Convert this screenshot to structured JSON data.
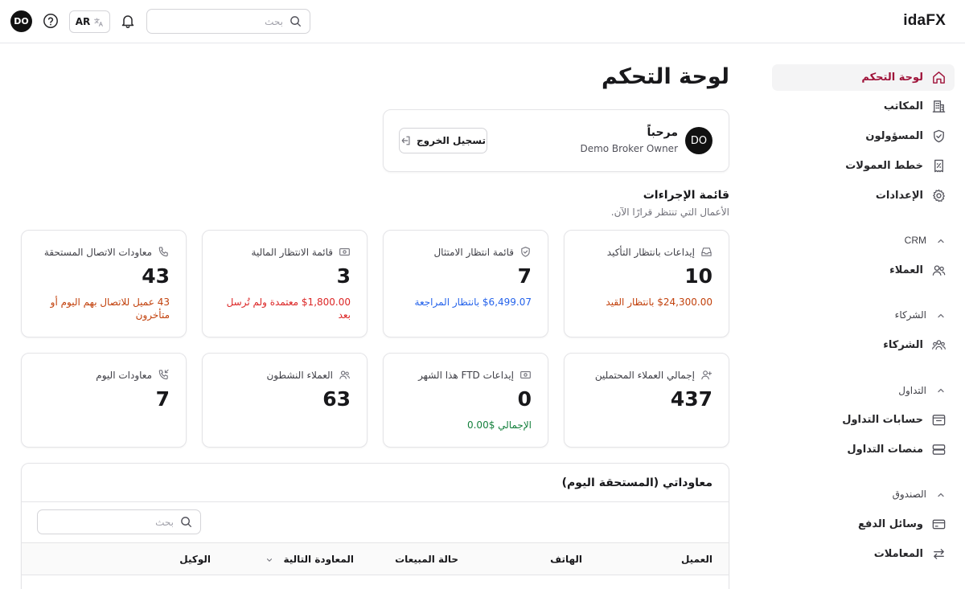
{
  "header": {
    "brand": "idaFX",
    "user_initials": "DO",
    "lang_label": "AR",
    "search_placeholder": "بحث"
  },
  "sidebar": {
    "items": [
      {
        "label": "لوحة التحكم",
        "icon": "home-icon",
        "active": true
      },
      {
        "label": "المكاتب",
        "icon": "building-icon"
      },
      {
        "label": "المسؤولون",
        "icon": "shield-icon"
      },
      {
        "label": "خطط العمولات",
        "icon": "percent-receipt-icon"
      },
      {
        "label": "الإعدادات",
        "icon": "gear-icon"
      }
    ],
    "groups": [
      {
        "title": "CRM",
        "items": [
          {
            "label": "العملاء",
            "icon": "users-icon"
          }
        ]
      },
      {
        "title": "الشركاء",
        "items": [
          {
            "label": "الشركاء",
            "icon": "partners-icon"
          }
        ]
      },
      {
        "title": "التداول",
        "items": [
          {
            "label": "حسابات التداول",
            "icon": "wallet-icon"
          },
          {
            "label": "منصات التداول",
            "icon": "server-icon"
          }
        ]
      },
      {
        "title": "الصندوق",
        "items": [
          {
            "label": "وسائل الدفع",
            "icon": "credit-card-icon"
          },
          {
            "label": "المعاملات",
            "icon": "arrows-exchange-icon"
          }
        ]
      }
    ]
  },
  "main": {
    "title": "لوحة التحكم",
    "welcome": {
      "initials": "DO",
      "greeting": "مرحباً",
      "name": "Demo Broker Owner",
      "logout": "تسجيل الخروج"
    },
    "actions": {
      "title": "قائمة الإجراءات",
      "subtitle": "الأعمال التي تنتظر قرارًا الآن."
    },
    "stats_row1": [
      {
        "label": "إيداعات بانتظار التأكيد",
        "value": "10",
        "note": "$24,300.00 بانتظار القيد",
        "note_color": "#c2410c",
        "icon": "inbox-icon"
      },
      {
        "label": "قائمة انتظار الامتثال",
        "value": "7",
        "note": "$6,499.07 بانتظار المراجعة",
        "note_color": "#2563eb",
        "icon": "shield-check-icon"
      },
      {
        "label": "قائمة الانتظار المالية",
        "value": "3",
        "note": "$1,800.00 معتمدة ولم تُرسل بعد",
        "note_color": "#dc2626",
        "icon": "banknote-icon"
      },
      {
        "label": "معاودات الاتصال المستحقة",
        "value": "43",
        "note": "43 عميل للاتصال بهم اليوم أو متأخرون",
        "note_color": "#c2410c",
        "icon": "phone-icon"
      }
    ],
    "stats_row2": [
      {
        "label": "إجمالي العملاء المحتملين",
        "value": "437",
        "note": "",
        "icon": "user-plus-icon"
      },
      {
        "label": "إيداعات FTD هذا الشهر",
        "value": "0",
        "note": "الإجمالي $0.00",
        "note_color": "#15803d",
        "icon": "banknote-icon"
      },
      {
        "label": "العملاء النشطون",
        "value": "63",
        "note": "",
        "icon": "users-icon"
      },
      {
        "label": "معاودات اليوم",
        "value": "7",
        "note": "",
        "icon": "phone-callback-icon"
      }
    ],
    "callbacks": {
      "title": "معاوداتي (المستحقة اليوم)",
      "search_placeholder": "بحث",
      "columns": [
        "العميل",
        "الهاتف",
        "حالة المبيعات",
        "المعاودة التالية",
        "الوكيل"
      ]
    }
  }
}
